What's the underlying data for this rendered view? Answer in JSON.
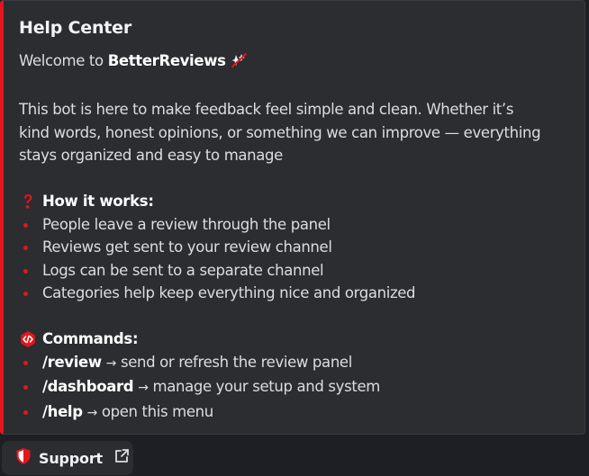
{
  "embed": {
    "accent_color": "#e5151c",
    "title": "Help Center",
    "welcome_prefix": "Welcome to ",
    "welcome_brand": "BetterReviews",
    "welcome_emoji": "sparkle-crossed-icon",
    "intro_lines": [
      "This bot is here to make feedback feel simple and clean. Whether it’s",
      "kind words, honest opinions, or something we can improve — everything",
      "stays organized and easy to manage"
    ],
    "how_it_works": {
      "icon": "question-mark-icon",
      "heading": "How it works:",
      "items": [
        "People leave a review through the panel",
        "Reviews get sent to your review channel",
        "Logs can be sent to a separate channel",
        "Categories help keep everything nice and organized"
      ]
    },
    "commands": {
      "icon": "code-badge-icon",
      "heading": "Commands:",
      "items": [
        {
          "command": "/review",
          "arrow": "→",
          "text": " send or refresh the review panel"
        },
        {
          "command": "/dashboard",
          "arrow": "→",
          "text": " manage your setup and system"
        },
        {
          "command": "/help",
          "arrow": "→",
          "text": " open this menu"
        }
      ]
    }
  },
  "support_button": {
    "label": "Support",
    "icon": "shield-icon",
    "link_icon": "external-link-icon"
  }
}
